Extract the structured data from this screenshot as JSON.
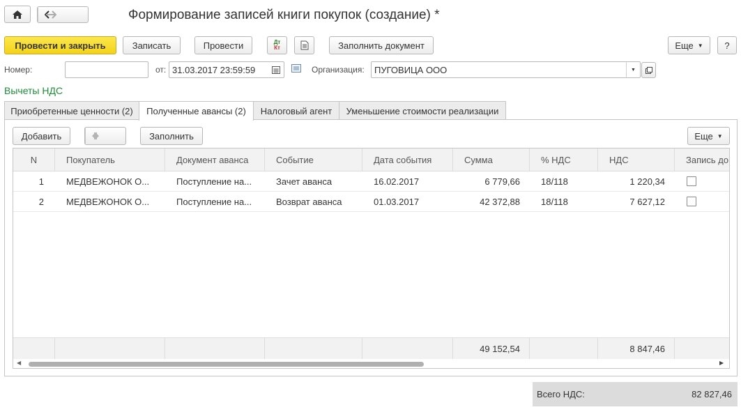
{
  "window": {
    "title": "Формирование записей книги покупок (создание) *"
  },
  "toolbar": {
    "post_close_label": "Провести и закрыть",
    "save_label": "Записать",
    "post_label": "Провести",
    "dt_kt_label_top": "Дт",
    "dt_kt_label_bottom": "Кт",
    "fill_document_label": "Заполнить документ",
    "more_label": "Еще",
    "help_label": "?"
  },
  "header": {
    "number_label": "Номер:",
    "number_value": "",
    "date_label": "от:",
    "date_value": "31.03.2017 23:59:59",
    "org_label": "Организация:",
    "org_value": "ПУГОВИЦА ООО"
  },
  "section": {
    "title": "Вычеты НДС"
  },
  "tabs": [
    {
      "label": "Приобретенные ценности (2)"
    },
    {
      "label": "Полученные авансы (2)"
    },
    {
      "label": "Налоговый агент"
    },
    {
      "label": "Уменьшение стоимости реализации"
    }
  ],
  "table_toolbar": {
    "add_label": "Добавить",
    "fill_label": "Заполнить",
    "more_label": "Еще"
  },
  "table": {
    "columns": [
      "N",
      "Покупатель",
      "Документ аванса",
      "Событие",
      "Дата события",
      "Сумма",
      "% НДС",
      "НДС",
      "Запись до"
    ],
    "rows": [
      {
        "n": "1",
        "buyer": "МЕДВЕЖОНОК О...",
        "doc": "Поступление на...",
        "event": "Зачет аванса",
        "date": "16.02.2017",
        "sum": "6 779,66",
        "rate": "18/118",
        "vat": "1 220,34",
        "checked": false
      },
      {
        "n": "2",
        "buyer": "МЕДВЕЖОНОК О...",
        "doc": "Поступление на...",
        "event": "Возврат аванса",
        "date": "01.03.2017",
        "sum": "42 372,88",
        "rate": "18/118",
        "vat": "7 627,12",
        "checked": false
      }
    ],
    "totals": {
      "sum": "49 152,54",
      "vat": "8 847,46"
    }
  },
  "footer": {
    "total_vat_label": "Всего НДС:",
    "total_vat_value": "82 827,46"
  },
  "colors": {
    "primary_button": "#f4d219",
    "section_title": "#1d8d3a"
  }
}
